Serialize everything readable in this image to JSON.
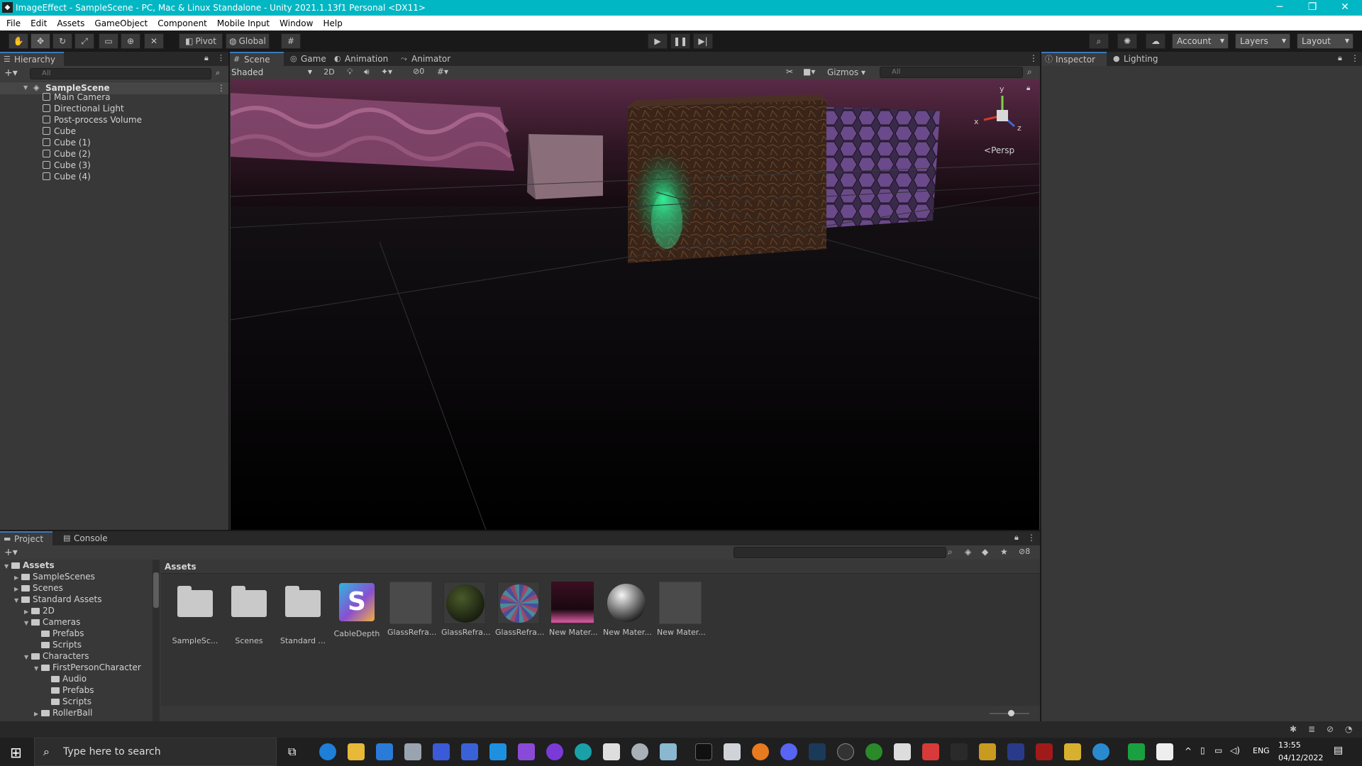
{
  "window": {
    "title": "ImageEffect - SampleScene - PC, Mac & Linux Standalone - Unity 2021.1.13f1 Personal <DX11>",
    "minimize": "─",
    "maximize": "❐",
    "close": "✕"
  },
  "menu": [
    "File",
    "Edit",
    "Assets",
    "GameObject",
    "Component",
    "Mobile Input",
    "Window",
    "Help"
  ],
  "toolbar": {
    "pivot": "Pivot",
    "global": "Global",
    "account": "Account",
    "layers": "Layers",
    "layout": "Layout"
  },
  "hierarchy": {
    "tab": "Hierarchy",
    "search_placeholder": "All",
    "scene": "SampleScene",
    "items": [
      "Main Camera",
      "Directional Light",
      "Post-process Volume",
      "Cube",
      "Cube (1)",
      "Cube (2)",
      "Cube (3)",
      "Cube (4)"
    ]
  },
  "scene_view": {
    "tabs": [
      "Scene",
      "Game",
      "Animation",
      "Animator"
    ],
    "shading": "Shaded",
    "mode_2d": "2D",
    "hidden_count": "0",
    "gizmos": "Gizmos",
    "search_placeholder": "All",
    "gizmo_y": "y",
    "gizmo_x": "x",
    "gizmo_z": "z",
    "projection": "Persp"
  },
  "inspector": {
    "tabs": [
      "Inspector",
      "Lighting"
    ]
  },
  "project": {
    "tabs": [
      "Project",
      "Console"
    ],
    "hidden_count": "8",
    "breadcrumb": "Assets",
    "tree": [
      {
        "label": "Assets",
        "depth": 0,
        "expanded": true,
        "bold": true
      },
      {
        "label": "SampleScenes",
        "depth": 1,
        "expanded": false
      },
      {
        "label": "Scenes",
        "depth": 1,
        "expanded": false
      },
      {
        "label": "Standard Assets",
        "depth": 1,
        "expanded": true
      },
      {
        "label": "2D",
        "depth": 2,
        "expanded": false
      },
      {
        "label": "Cameras",
        "depth": 2,
        "expanded": true
      },
      {
        "label": "Prefabs",
        "depth": 3,
        "leaf": true
      },
      {
        "label": "Scripts",
        "depth": 3,
        "leaf": true
      },
      {
        "label": "Characters",
        "depth": 2,
        "expanded": true
      },
      {
        "label": "FirstPersonCharacter",
        "depth": 3,
        "expanded": true
      },
      {
        "label": "Audio",
        "depth": 4,
        "leaf": true
      },
      {
        "label": "Prefabs",
        "depth": 4,
        "leaf": true
      },
      {
        "label": "Scripts",
        "depth": 4,
        "leaf": true
      },
      {
        "label": "RollerBall",
        "depth": 3,
        "expanded": false
      }
    ],
    "assets": [
      {
        "label": "SampleSc...",
        "kind": "folder"
      },
      {
        "label": "Scenes",
        "kind": "folder"
      },
      {
        "label": "Standard ...",
        "kind": "folder"
      },
      {
        "label": "CableDepth",
        "kind": "shader",
        "glyph": "S"
      },
      {
        "label": "GlassRefra...",
        "kind": "grey"
      },
      {
        "label": "GlassRefra...",
        "kind": "green-sphere"
      },
      {
        "label": "GlassRefra...",
        "kind": "mosaic-sphere"
      },
      {
        "label": "New Mater...",
        "kind": "pink-gradient"
      },
      {
        "label": "New Mater...",
        "kind": "grey-sphere"
      },
      {
        "label": "New Mater...",
        "kind": "grey"
      }
    ]
  },
  "taskbar": {
    "search_placeholder": "Type here to search",
    "language": "ENG",
    "time": "13:55",
    "date": "04/12/2022"
  }
}
